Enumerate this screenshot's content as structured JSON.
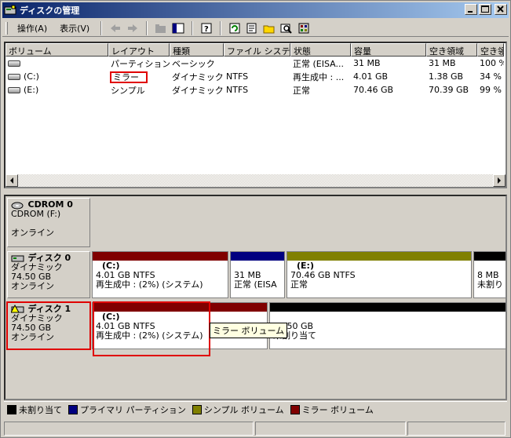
{
  "window": {
    "title": "ディスクの管理"
  },
  "menu": {
    "action": "操作(A)",
    "view": "表示(V)"
  },
  "columns": [
    "ボリューム",
    "レイアウト",
    "種類",
    "ファイル システ…",
    "状態",
    "容量",
    "空き領域",
    "空き領"
  ],
  "volumes": [
    {
      "name": "",
      "layout": "パーティション",
      "type": "ベーシック",
      "fs": "",
      "status": "正常 (EISA...",
      "capacity": "31 MB",
      "free": "31 MB",
      "pct": "100 %"
    },
    {
      "name": "(C:)",
      "layout": "ミラー",
      "type": "ダイナミック",
      "fs": "NTFS",
      "status": "再生成中 : ...",
      "capacity": "4.01 GB",
      "free": "1.38 GB",
      "pct": "34 %"
    },
    {
      "name": "(E:)",
      "layout": "シンプル",
      "type": "ダイナミック",
      "fs": "NTFS",
      "status": "正常",
      "capacity": "70.46 GB",
      "free": "70.39 GB",
      "pct": "99 %"
    }
  ],
  "disks": {
    "cdrom": {
      "name": "CDROM 0",
      "line1": "CDROM (F:)",
      "line2": "",
      "line3": "オンライン"
    },
    "disk0": {
      "name": "ディスク 0",
      "line1": "ダイナミック",
      "line2": "74.50 GB",
      "line3": "オンライン",
      "parts": [
        {
          "label": "(C:)",
          "l1": "4.01 GB NTFS",
          "l2": "再生成中 : (2%) (システム)"
        },
        {
          "label": "",
          "l1": "31 MB",
          "l2": "正常 (EISA"
        },
        {
          "label": "(E:)",
          "l1": "70.46 GB NTFS",
          "l2": "正常"
        },
        {
          "label": "",
          "l1": "8 MB",
          "l2": "未割り"
        }
      ]
    },
    "disk1": {
      "name": "ディスク 1",
      "line1": "ダイナミック",
      "line2": "74.50 GB",
      "line3": "オンライン",
      "parts": [
        {
          "label": "(C:)",
          "l1": "4.01 GB NTFS",
          "l2": "再生成中 : (2%) (システム)"
        },
        {
          "label": "",
          "l1": "70.50 GB",
          "l2": "未割り当て"
        }
      ]
    }
  },
  "tooltip": "ミラー ボリューム",
  "legend": [
    {
      "label": "未割り当て",
      "color": "#000000"
    },
    {
      "label": "プライマリ パーティション",
      "color": "#000080"
    },
    {
      "label": "シンプル ボリューム",
      "color": "#808000"
    },
    {
      "label": "ミラー ボリューム",
      "color": "#800000"
    }
  ]
}
